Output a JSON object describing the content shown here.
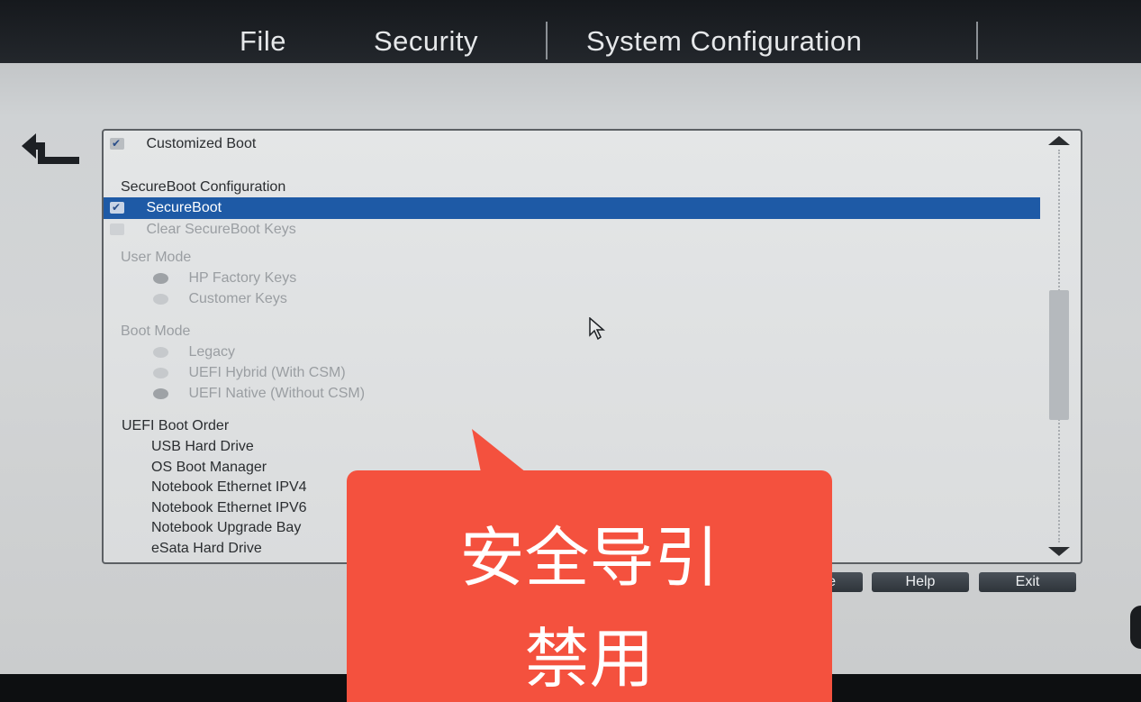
{
  "menu": {
    "file": "File",
    "security": "Security",
    "system_configuration": "System Configuration"
  },
  "content": {
    "customized_boot": "Customized Boot",
    "secureboot_config_heading": "SecureBoot Configuration",
    "secureboot": "SecureBoot",
    "clear_keys": "Clear SecureBoot Keys",
    "user_mode_heading": "User Mode",
    "user_mode_options": [
      "HP Factory Keys",
      "Customer Keys"
    ],
    "boot_mode_heading": "Boot Mode",
    "boot_mode_options": [
      "Legacy",
      "UEFI Hybrid (With CSM)",
      "UEFI Native (Without CSM)"
    ],
    "uefi_boot_order_heading": "UEFI Boot Order",
    "boot_order": [
      "USB Hard Drive",
      "OS Boot Manager",
      "Notebook Ethernet IPV4",
      "Notebook Ethernet IPV6",
      "Notebook Upgrade Bay",
      "eSata Hard Drive"
    ]
  },
  "buttons": {
    "save_partial": "e",
    "help": "Help",
    "exit": "Exit"
  },
  "overlay": {
    "line1": "安全导引",
    "line2": "禁用",
    "color": "#f4513e"
  },
  "icons": {
    "back": "back-arrow-icon",
    "pointer": "mouse-pointer-icon"
  },
  "state": {
    "customized_boot_checked": true,
    "secureboot_checked": true,
    "clear_keys_checked": false,
    "user_mode_selected": "HP Factory Keys",
    "boot_mode_selected": "UEFI Native (Without CSM)"
  }
}
